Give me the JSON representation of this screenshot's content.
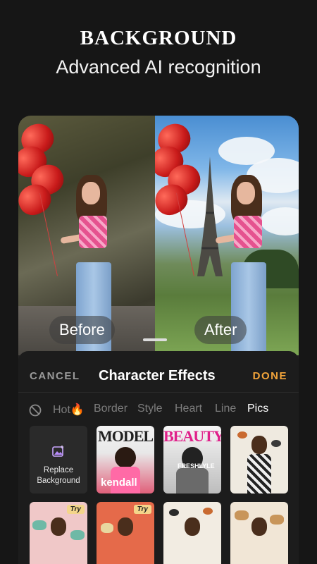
{
  "headline": "BACKGROUND",
  "subline": "Advanced AI recognition",
  "preview": {
    "before_label": "Before",
    "after_label": "After"
  },
  "sheet": {
    "cancel": "CANCEL",
    "title": "Character Effects",
    "done": "DONE",
    "none_icon": "no-effect-icon",
    "tabs": [
      "Hot🔥",
      "Border",
      "Style",
      "Heart",
      "Line",
      "Pics"
    ],
    "active_tab": "Pics",
    "replace_tile": {
      "icon": "replace-image-icon",
      "label_line1": "Replace",
      "label_line2": "Background"
    },
    "tiles": [
      {
        "mag_title": "MODEL",
        "mag_sub": "kendall",
        "try": ""
      },
      {
        "mag_title": "BEAUTY",
        "mag_sub": "FRESHLYLE",
        "try": ""
      },
      {
        "mag_title": "",
        "mag_sub": "",
        "try": ""
      },
      {
        "mag_title": "",
        "mag_sub": "",
        "try": "Try"
      },
      {
        "mag_title": "",
        "mag_sub": "",
        "try": "Try"
      },
      {
        "mag_title": "",
        "mag_sub": "",
        "try": ""
      },
      {
        "mag_title": "",
        "mag_sub": "",
        "try": ""
      }
    ]
  },
  "colors": {
    "background": "#161616",
    "accent": "#f2a43a",
    "tab_inactive": "#7d7d7d"
  }
}
